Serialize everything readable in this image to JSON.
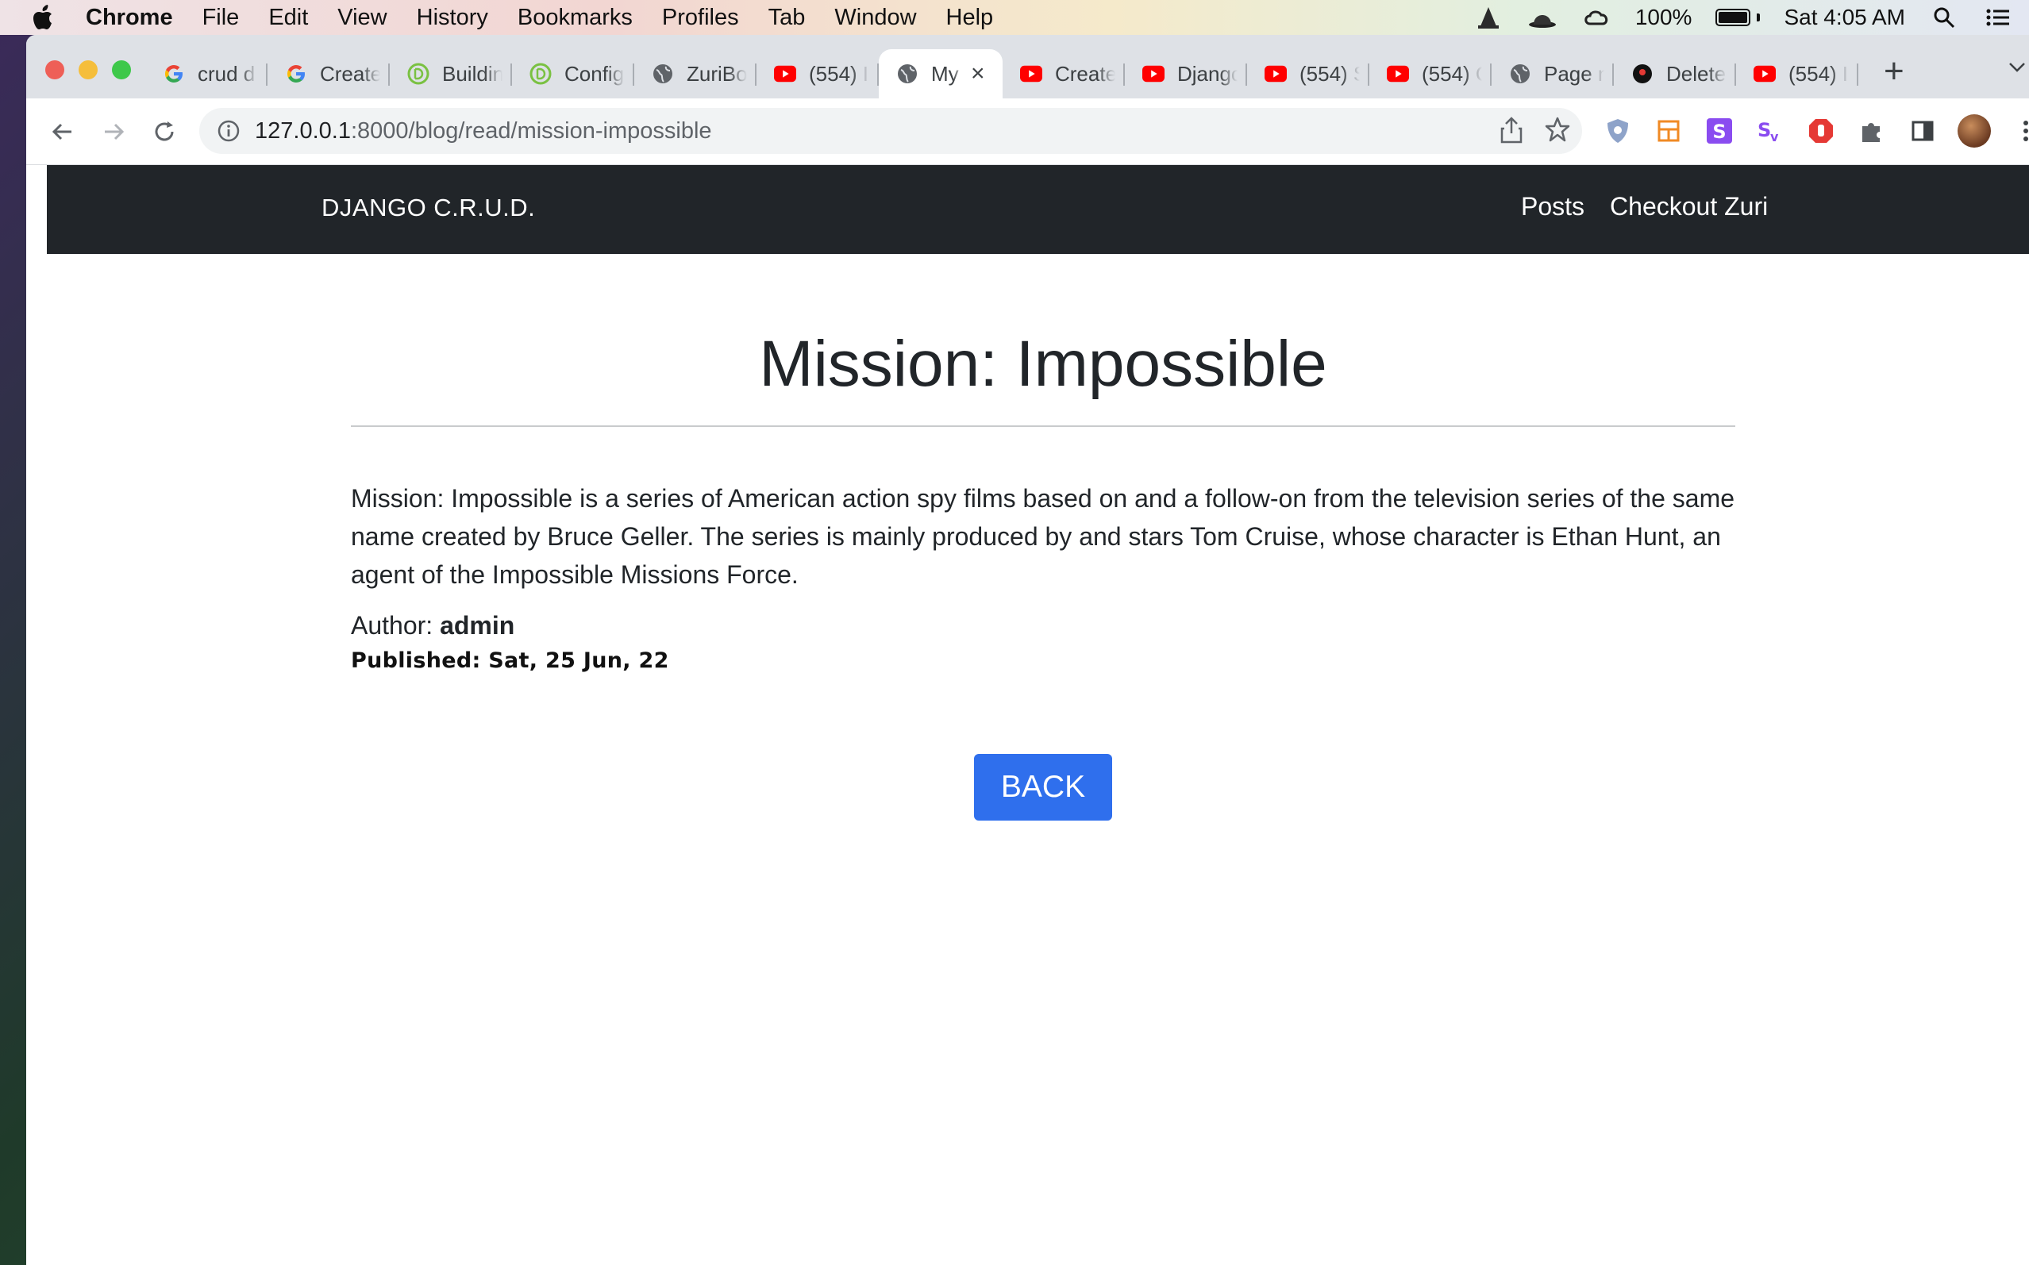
{
  "os_menubar": {
    "app": "Chrome",
    "items": [
      "File",
      "Edit",
      "View",
      "History",
      "Bookmarks",
      "Profiles",
      "Tab",
      "Window",
      "Help"
    ],
    "battery": "100%",
    "clock": "Sat 4:05 AM",
    "battery_level": 1.0
  },
  "browser": {
    "tabs": [
      {
        "label": "crud d",
        "icon": "google-icon"
      },
      {
        "label": "Create",
        "icon": "google-icon"
      },
      {
        "label": "Buildin",
        "icon": "d-icon"
      },
      {
        "label": "Config",
        "icon": "d-icon"
      },
      {
        "label": "ZuriBo",
        "icon": "globe-icon"
      },
      {
        "label": "(554) I",
        "icon": "youtube-icon"
      },
      {
        "label": "My",
        "icon": "globe-icon",
        "active": true
      },
      {
        "label": "Create",
        "icon": "youtube-icon"
      },
      {
        "label": "Djangc",
        "icon": "youtube-icon"
      },
      {
        "label": "(554) S",
        "icon": "youtube-icon"
      },
      {
        "label": "(554) C",
        "icon": "youtube-icon"
      },
      {
        "label": "Page n",
        "icon": "globe-icon"
      },
      {
        "label": "Delete",
        "icon": "dark-circle-icon"
      },
      {
        "label": "(554) I",
        "icon": "youtube-icon"
      }
    ],
    "url_host": "127.0.0.1",
    "url_path": ":8000/blog/read/mission-impossible"
  },
  "site": {
    "brand": "DJANGO C.R.U.D.",
    "nav": [
      "Posts",
      "Checkout Zuri"
    ]
  },
  "post": {
    "title": "Mission: Impossible",
    "body": "Mission: Impossible is a series of American action spy films based on and a follow-on from the television series of the same name created by Bruce Geller. The series is mainly produced by and stars Tom Cruise, whose character is Ethan Hunt, an agent of the Impossible Missions Force.",
    "author_label": "Author:",
    "author": "admin",
    "published": "Published: Sat, 25 Jun, 22",
    "back_label": "BACK"
  },
  "colors": {
    "navbar_bg": "#212529",
    "button_bg": "#2f6fed",
    "youtube_red": "#ff0000"
  }
}
